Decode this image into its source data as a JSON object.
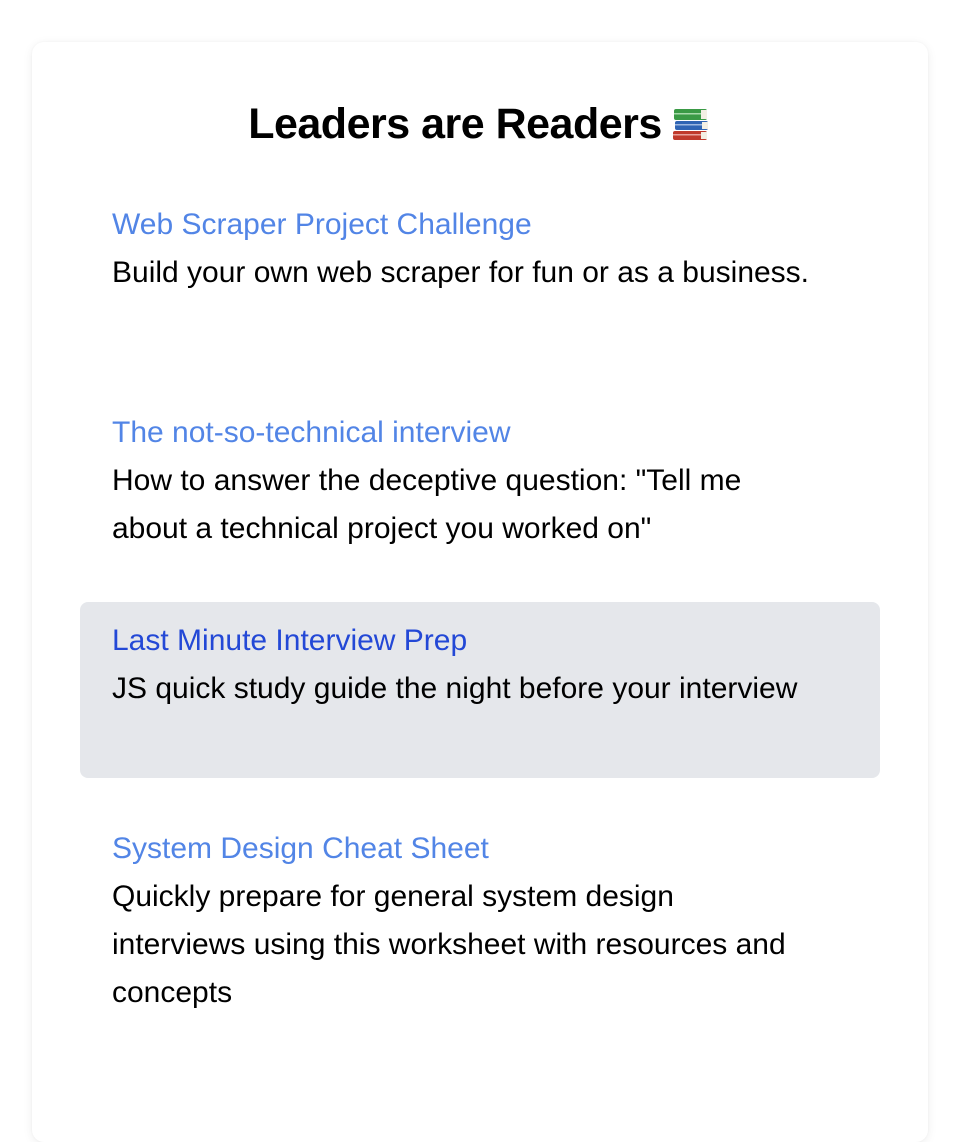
{
  "title": "Leaders are Readers",
  "title_icon": "books-icon",
  "colors": {
    "link": "#5285e6",
    "link_hover": "#2348d6",
    "highlight_bg": "#e5e7eb",
    "text": "#000000"
  },
  "articles": [
    {
      "title": "Web Scraper Project Challenge",
      "description": "Build your own web scraper for fun or as a business."
    },
    {
      "title": "The not-so-technical interview",
      "description": "How to answer the deceptive question: \"Tell me about a technical project you worked on\""
    },
    {
      "title": "Last Minute Interview Prep",
      "description": "JS quick study guide the night before your interview",
      "highlighted": true
    },
    {
      "title": "System Design Cheat Sheet",
      "description": "Quickly prepare for general system design interviews using this worksheet with resources and concepts"
    }
  ]
}
